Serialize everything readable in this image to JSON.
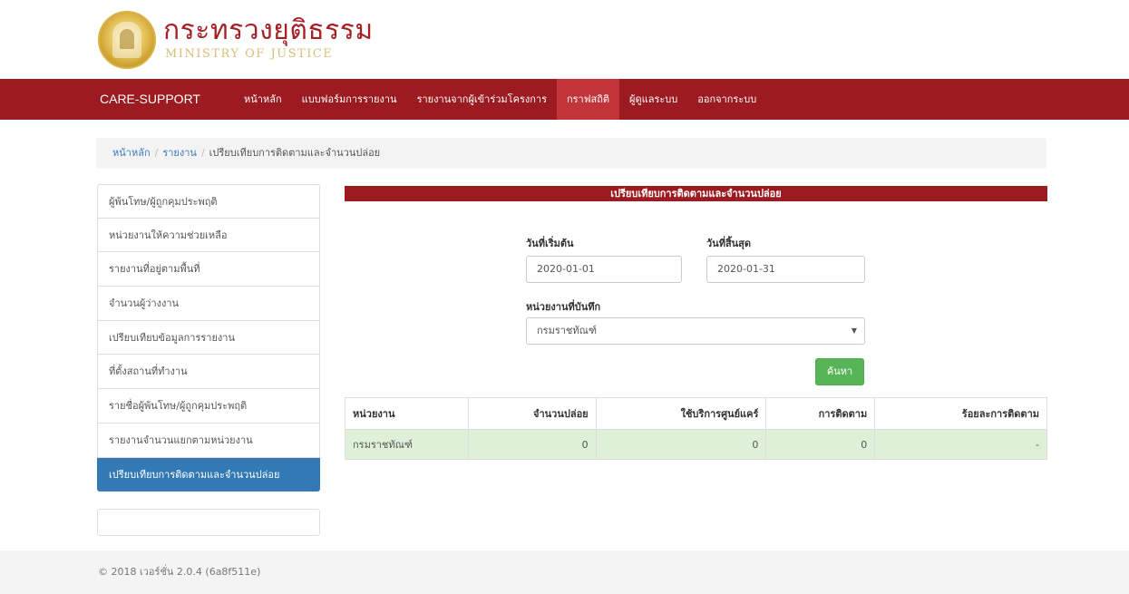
{
  "header": {
    "logo_th": "กระทรวงยุติธรรม",
    "logo_en": "MINISTRY OF JUSTICE"
  },
  "navbar": {
    "brand": "CARE-SUPPORT",
    "items": [
      {
        "label": "หน้าหลัก",
        "active": false
      },
      {
        "label": "แบบฟอร์มการรายงาน",
        "active": false
      },
      {
        "label": "รายงานจากผู้เข้าร่วมโครงการ",
        "active": false
      },
      {
        "label": "กราฟสถิติ",
        "active": true
      },
      {
        "label": "ผู้ดูแลระบบ",
        "active": false
      },
      {
        "label": "ออกจากระบบ",
        "active": false
      }
    ]
  },
  "breadcrumb": {
    "home": "หน้าหลัก",
    "reports": "รายงาน",
    "current": "เปรียบเทียบการติดตามและจำนวนปล่อย",
    "separator": "/"
  },
  "sidebar": {
    "items": [
      {
        "label": "ผู้พ้นโทษ/ผู้ถูกคุมประพฤติ"
      },
      {
        "label": "หน่วยงานให้ความช่วยเหลือ"
      },
      {
        "label": "รายงานที่อยู่ตามพื้นที่"
      },
      {
        "label": "จำนวนผู้ว่างงาน"
      },
      {
        "label": "เปรียบเทียบข้อมูลการรายงาน"
      },
      {
        "label": "ที่ตั้งสถานที่ทำงาน"
      },
      {
        "label": "รายชื่อผู้พ้นโทษ/ผู้ถูกคุมประพฤติ"
      },
      {
        "label": "รายงานจำนวนแยกตามหน่วยงาน"
      },
      {
        "label": "เปรียบเทียบการติดตามและจำนวนปล่อย"
      }
    ],
    "active_index": 8
  },
  "main": {
    "title": "เปรียบเทียบการติดตามและจำนวนปล่อย",
    "start_date_label": "วันที่เริ่มต้น",
    "start_date_value": "2020-01-01",
    "end_date_label": "วันที่สิ้นสุด",
    "end_date_value": "2020-01-31",
    "agency_label": "หน่วยงานที่บันทึก",
    "agency_selected": "กรมราชทัณฑ์",
    "search_button": "ค้นหา"
  },
  "table": {
    "headers": [
      "หน่วยงาน",
      "จำนวนปล่อย",
      "ใช้บริการศูนย์แคร์",
      "การติดตาม",
      "ร้อยละการติดตาม"
    ],
    "rows": [
      [
        "กรมราชทัณฑ์",
        "0",
        "0",
        "0",
        "-"
      ]
    ]
  },
  "footer": {
    "text": "© 2018 เวอร์ชั่น 2.0.4 (6a8f511e)"
  },
  "colors": {
    "primary_red": "#9b1b20",
    "active_nav": "#c0343a",
    "sidebar_active": "#3379b5",
    "search_button": "#57b557",
    "row_highlight": "#dff0d8",
    "logo_gold": "#d7bf7a"
  },
  "icons": {
    "logo": "ministry-seal-icon",
    "select_caret": "caret-down-icon"
  }
}
